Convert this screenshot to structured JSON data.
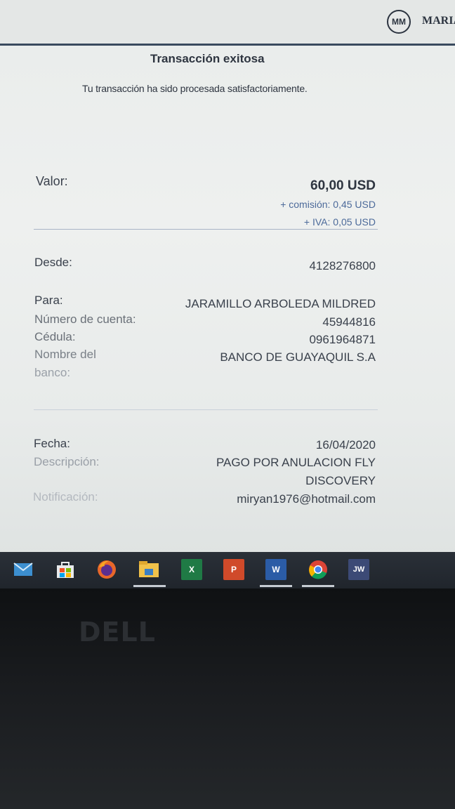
{
  "header": {
    "avatar_initials": "MM",
    "user_name": "MARIA"
  },
  "transaction": {
    "title": "Transacción exitosa",
    "subtitle": "Tu transacción ha sido procesada satisfactoriamente."
  },
  "amount": {
    "label": "Valor:",
    "value": "60,00 USD",
    "commission": "+ comisión: 0,45 USD",
    "iva": "+ IVA: 0,05 USD"
  },
  "from": {
    "label": "Desde:",
    "value": "4128276800"
  },
  "recipient": {
    "to_label": "Para:",
    "to_value": "JARAMILLO ARBOLEDA MILDRED",
    "account_label": "Número de cuenta:",
    "account_value": "45944816",
    "id_label": "Cédula:",
    "id_value": "0961964871",
    "bank_label_line1": "Nombre del",
    "bank_label_line2": "banco:",
    "bank_value": "BANCO DE GUAYAQUIL S.A"
  },
  "details": {
    "date_label": "Fecha:",
    "date_value": "16/04/2020",
    "desc_label": "Descripción:",
    "desc_value_line1": "PAGO POR ANULACION FLY",
    "desc_value_line2": "DISCOVERY",
    "notif_label": "Notificación:",
    "notif_value": "miryan1976@hotmail.com"
  },
  "taskbar": {
    "apps": [
      {
        "name": "mail-icon",
        "glyph": "",
        "color": "#3c8fd0"
      },
      {
        "name": "store-icon",
        "glyph": "",
        "color": "#4a5563"
      },
      {
        "name": "firefox-icon",
        "glyph": "",
        "color": "#e8672a"
      },
      {
        "name": "file-explorer-icon",
        "glyph": "",
        "color": "#f1c24a"
      },
      {
        "name": "excel-icon",
        "glyph": "X",
        "color": "#1f7a45"
      },
      {
        "name": "powerpoint-icon",
        "glyph": "P",
        "color": "#d04a2a"
      },
      {
        "name": "word-icon",
        "glyph": "W",
        "color": "#2b5ca6"
      },
      {
        "name": "chrome-icon",
        "glyph": "",
        "color": "#e0a020"
      },
      {
        "name": "jw-icon",
        "glyph": "JW",
        "color": "#3c4a76"
      }
    ]
  },
  "brand": {
    "laptop_logo": "DELL"
  }
}
